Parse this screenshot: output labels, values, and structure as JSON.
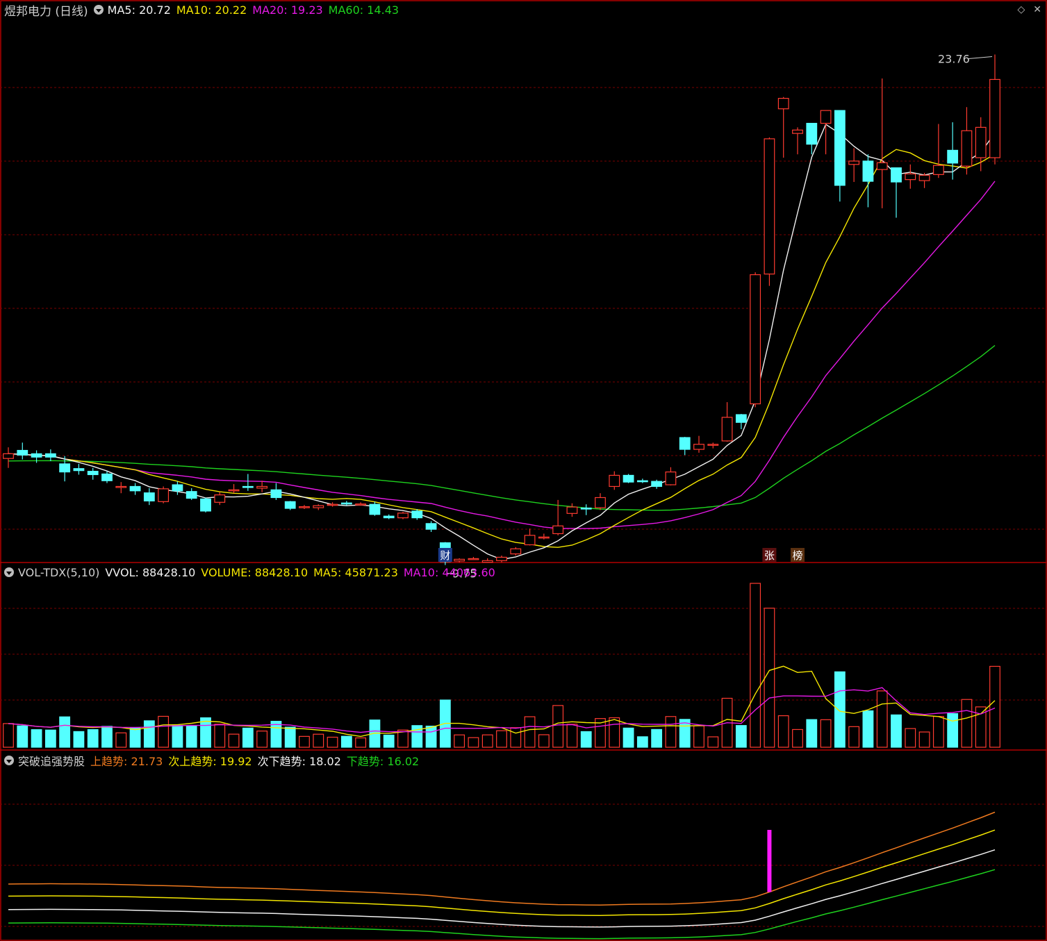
{
  "colors": {
    "bg": "#000000",
    "border": "#b10000",
    "grid": "#7a0000",
    "up": "#ff3b30",
    "down": "#54ffff",
    "ma5": "#f2f2f2",
    "ma10": "#f4e600",
    "ma20": "#e619e6",
    "ma60": "#1ed21e",
    "trend_up": "#f07a1f",
    "trend_up2": "#f4e600",
    "trend_down2": "#f2f2f2",
    "trend_down": "#1ed21e",
    "signal": "#ff19ff"
  },
  "price_panel": {
    "stock": "煜邦电力 (日线)",
    "ma5_label": "MA5: 20.72",
    "ma10_label": "MA10: 20.22",
    "ma20_label": "MA20: 19.23",
    "ma60_label": "MA60: 14.43",
    "high_label": "23.76",
    "low_label": "9.75",
    "marker_cai": "财",
    "marker_zhang": "张",
    "marker_bang": "榜"
  },
  "volume_panel": {
    "name": "VOL-TDX(5,10)",
    "vvol": "VVOL: 88428.10",
    "volume": "VOLUME: 88428.10",
    "ma5": "MA5: 45871.23",
    "ma10": "MA10: 44063.60"
  },
  "trend_panel": {
    "name": "突破追强势股",
    "up": "上趋势: 21.73",
    "up2": "次上趋势: 19.92",
    "down2": "次下趋势: 18.02",
    "down": "下趋势: 16.02"
  },
  "toolbar": {
    "diamond_icon": "diamond-icon",
    "close_icon": "close-icon"
  },
  "chart_data": {
    "type": "candlestick",
    "count": 60,
    "ylim_price": [
      8.9,
      24.8
    ],
    "candles": [
      [
        11.78,
        11.92,
        11.5,
        12.11
      ],
      [
        12.02,
        11.88,
        11.75,
        12.25
      ],
      [
        11.92,
        11.82,
        11.65,
        12.02
      ],
      [
        11.92,
        11.82,
        11.7,
        12.05
      ],
      [
        11.62,
        11.38,
        11.1,
        11.85
      ],
      [
        11.48,
        11.42,
        11.3,
        11.62
      ],
      [
        11.4,
        11.3,
        11.15,
        11.5
      ],
      [
        11.32,
        11.12,
        11.05,
        11.4
      ],
      [
        10.95,
        10.95,
        10.75,
        11.08
      ],
      [
        10.95,
        10.82,
        10.7,
        11.05
      ],
      [
        10.76,
        10.52,
        10.4,
        10.9
      ],
      [
        10.5,
        10.88,
        10.45,
        10.95
      ],
      [
        11.0,
        10.82,
        10.7,
        11.1
      ],
      [
        10.8,
        10.6,
        10.55,
        10.9
      ],
      [
        10.58,
        10.22,
        10.18,
        10.62
      ],
      [
        10.48,
        10.7,
        10.4,
        10.78
      ],
      [
        10.85,
        10.85,
        10.75,
        11.02
      ],
      [
        10.95,
        10.92,
        10.82,
        11.32
      ],
      [
        10.9,
        10.95,
        10.78,
        11.12
      ],
      [
        10.85,
        10.62,
        10.55,
        11.05
      ],
      [
        10.5,
        10.3,
        10.25,
        10.52
      ],
      [
        10.32,
        10.35,
        10.28,
        10.4
      ],
      [
        10.32,
        10.38,
        10.25,
        10.42
      ],
      [
        10.42,
        10.42,
        10.35,
        10.48
      ],
      [
        10.46,
        10.44,
        10.38,
        10.52
      ],
      [
        10.43,
        10.43,
        10.38,
        10.48
      ],
      [
        10.42,
        10.12,
        10.08,
        10.5
      ],
      [
        10.07,
        10.02,
        9.98,
        10.12
      ],
      [
        10.02,
        10.16,
        9.98,
        10.2
      ],
      [
        10.22,
        10.02,
        9.96,
        10.28
      ],
      [
        9.85,
        9.68,
        9.6,
        9.92
      ],
      [
        9.28,
        8.72,
        8.62,
        9.3
      ],
      [
        8.74,
        8.79,
        8.7,
        8.82
      ],
      [
        8.8,
        8.81,
        8.78,
        8.86
      ],
      [
        8.7,
        8.75,
        8.7,
        8.82
      ],
      [
        8.75,
        8.85,
        8.7,
        8.9
      ],
      [
        8.95,
        9.1,
        8.9,
        9.15
      ],
      [
        9.22,
        9.5,
        9.2,
        9.7
      ],
      [
        9.42,
        9.45,
        9.38,
        9.55
      ],
      [
        9.55,
        9.78,
        9.5,
        10.55
      ],
      [
        10.15,
        10.34,
        10.05,
        10.45
      ],
      [
        10.31,
        10.28,
        10.1,
        10.42
      ],
      [
        10.32,
        10.62,
        10.25,
        10.75
      ],
      [
        10.95,
        11.28,
        10.85,
        11.4
      ],
      [
        11.28,
        11.08,
        11.05,
        11.32
      ],
      [
        11.12,
        11.1,
        11.05,
        11.18
      ],
      [
        11.1,
        10.95,
        10.88,
        11.15
      ],
      [
        11.0,
        11.38,
        10.98,
        11.52
      ],
      [
        12.4,
        12.05,
        11.88,
        12.42
      ],
      [
        12.05,
        12.2,
        11.95,
        12.45
      ],
      [
        12.2,
        12.2,
        12.08,
        12.25
      ],
      [
        12.3,
        13.0,
        12.28,
        13.45
      ],
      [
        13.08,
        12.85,
        12.65,
        13.1
      ],
      [
        13.4,
        17.23,
        13.3,
        17.3
      ],
      [
        17.25,
        21.26,
        16.9,
        21.3
      ],
      [
        22.15,
        22.46,
        20.7,
        22.5
      ],
      [
        21.42,
        21.52,
        20.8,
        21.6
      ],
      [
        21.72,
        21.1,
        20.8,
        21.72
      ],
      [
        21.72,
        22.1,
        20.8,
        22.1
      ],
      [
        22.1,
        19.88,
        19.4,
        22.1
      ],
      [
        20.5,
        20.6,
        19.98,
        20.98
      ],
      [
        20.6,
        20.0,
        19.23,
        20.8
      ],
      [
        20.35,
        20.55,
        19.2,
        23.05
      ],
      [
        20.4,
        19.98,
        18.92,
        20.4
      ],
      [
        20.05,
        20.22,
        19.78,
        20.5
      ],
      [
        20.02,
        20.18,
        19.8,
        20.25
      ],
      [
        20.2,
        20.47,
        20.1,
        21.7
      ],
      [
        20.92,
        20.54,
        20.05,
        21.75
      ],
      [
        20.45,
        21.5,
        20.2,
        22.2
      ],
      [
        20.7,
        21.6,
        20.3,
        21.9
      ],
      [
        20.7,
        23.02,
        20.5,
        23.76
      ]
    ]
  }
}
